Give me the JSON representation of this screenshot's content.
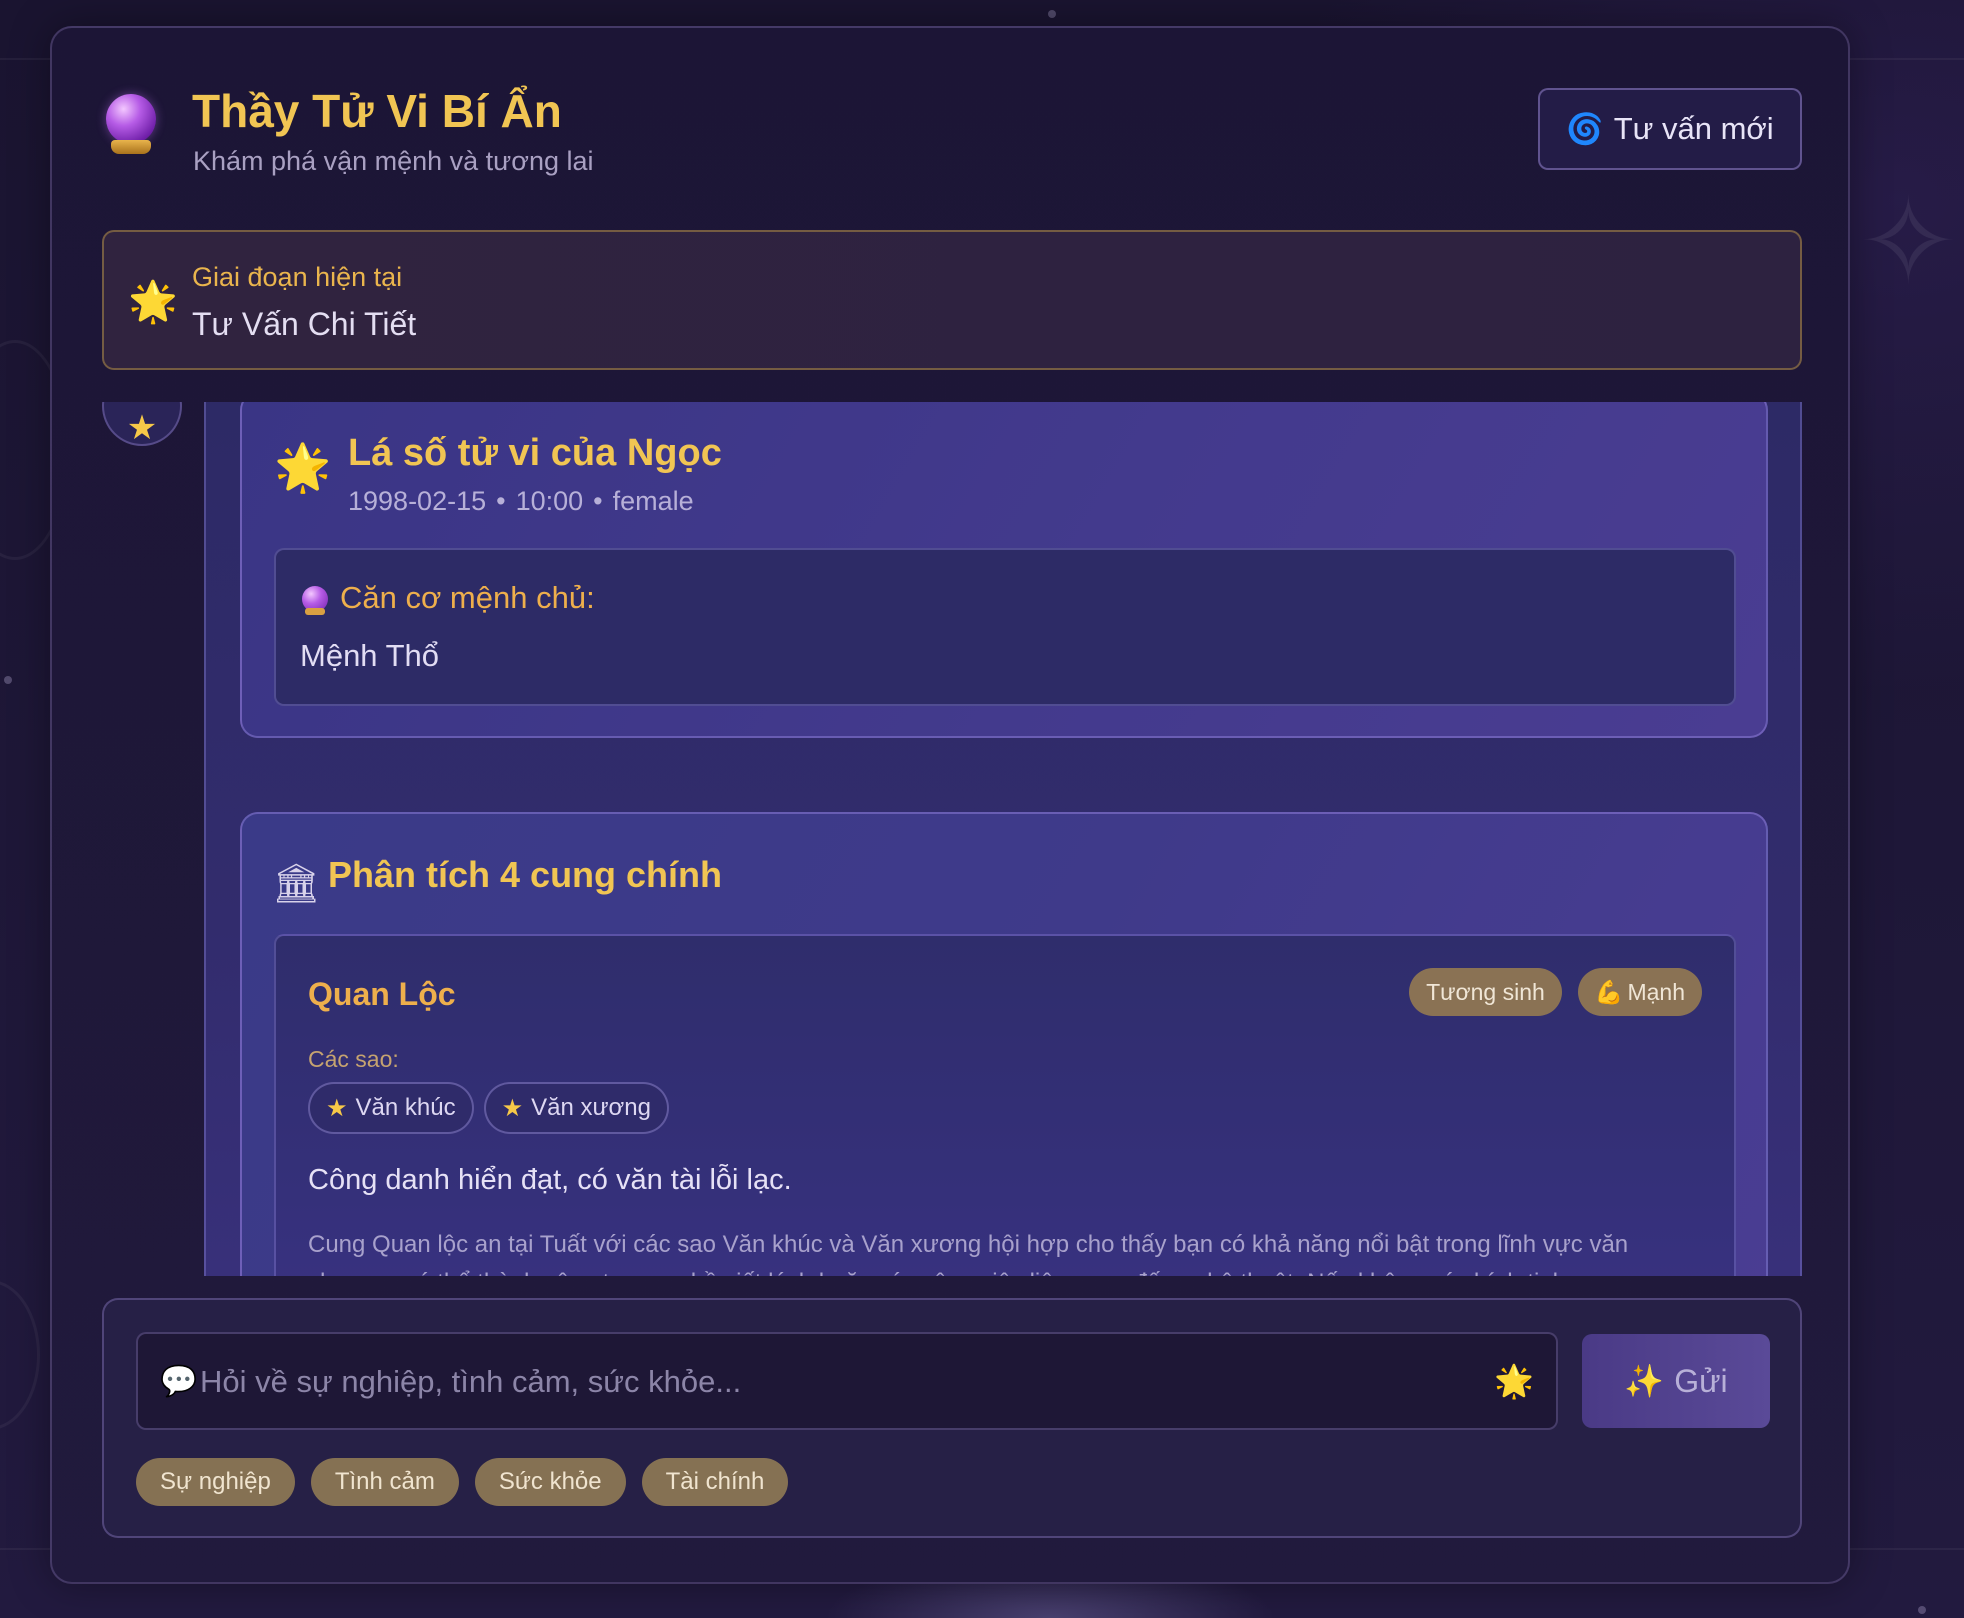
{
  "header": {
    "title": "Thầy Tử Vi Bí Ẩn",
    "subtitle": "Khám phá vận mệnh và tương lai",
    "new_consult_label": "Tư vấn mới"
  },
  "stage": {
    "label": "Giai đoạn hiện tại",
    "value": "Tư Vấn Chi Tiết"
  },
  "chart_card": {
    "title": "Lá số tử vi của Ngọc",
    "birth_date": "1998-02-15",
    "birth_time": "10:00",
    "gender": "female",
    "separator": "•",
    "destiny_label": "Căn cơ mệnh chủ:",
    "destiny_value": "Mệnh Thổ"
  },
  "analysis_card": {
    "title": "Phân tích 4 cung chính",
    "palace": {
      "name": "Quan Lộc",
      "tags": [
        {
          "icon": "",
          "label": "Tương sinh"
        },
        {
          "icon": "💪",
          "label": "Mạnh"
        }
      ],
      "stars_label": "Các sao:",
      "stars": [
        "Văn khúc",
        "Văn xương"
      ],
      "summary": "Công danh hiển đạt, có văn tài lỗi lạc.",
      "detail": "Cung Quan lộc an tại Tuất với các sao Văn khúc và Văn xương hội hợp cho thấy bạn có khả năng nổi bật trong lĩnh vực văn chương, có thể thành công trong nghề viết lách hoặc các công việc liên quan đến nghệ thuật. Nếu không có chính tinh"
    }
  },
  "composer": {
    "placeholder": "Hỏi về sự nghiệp, tình cảm, sức khỏe...",
    "send_label": "Gửi",
    "quick_topics": [
      "Sự nghiệp",
      "Tình cảm",
      "Sức khỏe",
      "Tài chính"
    ]
  },
  "icons": {
    "logo": "crystal-ball-icon",
    "new_consult": "spiral-icon",
    "stage": "glowing-star-icon",
    "analysis": "classical-building-icon",
    "send": "sparkles-icon"
  },
  "colors": {
    "accent_gold": "#f1c553",
    "accent_orange": "#eeaf4c",
    "background": "#1b1533",
    "card": "#3a3585",
    "tag": "#8a7254"
  }
}
